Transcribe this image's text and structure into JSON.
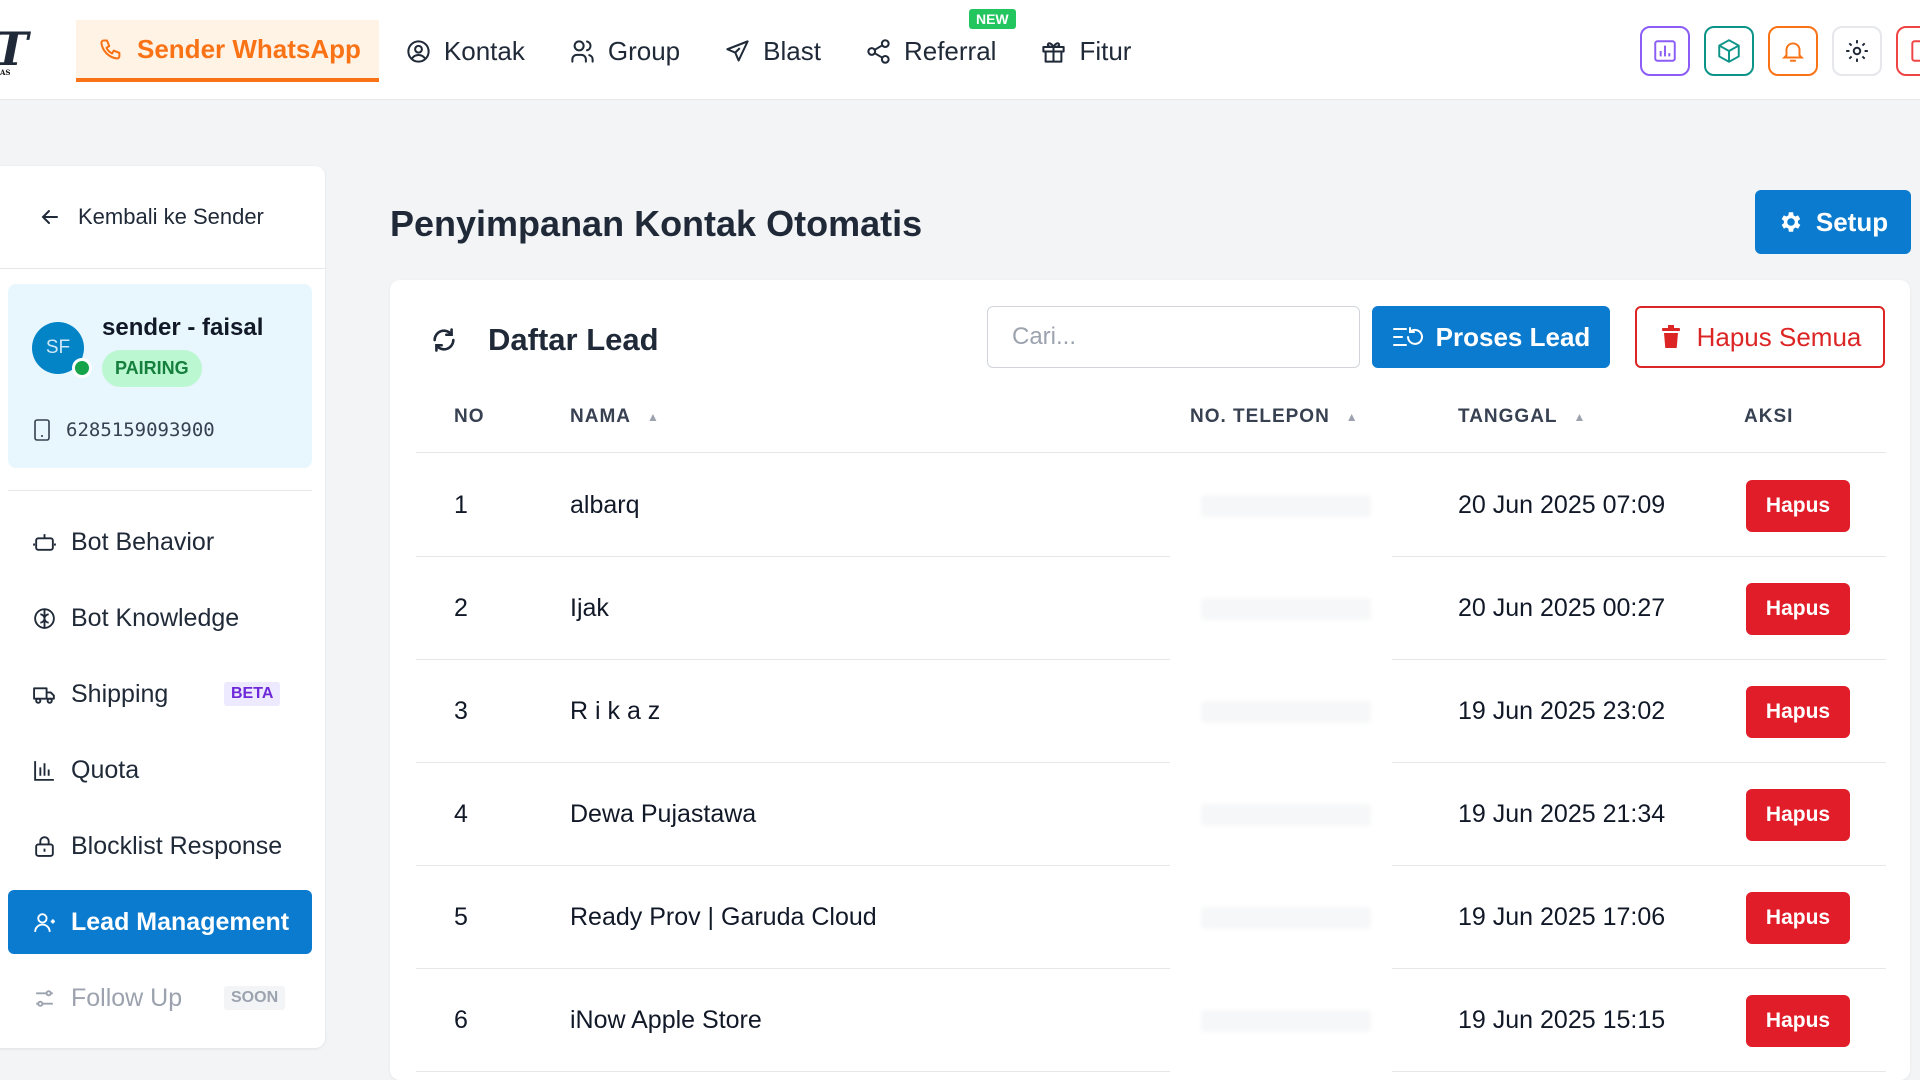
{
  "brand": {
    "logo_text": "T",
    "logo_sub": "AS"
  },
  "nav": {
    "items": [
      {
        "label": "Sender WhatsApp",
        "icon": "phone-icon",
        "active": true
      },
      {
        "label": "Kontak",
        "icon": "user-circle-icon"
      },
      {
        "label": "Group",
        "icon": "users-icon"
      },
      {
        "label": "Blast",
        "icon": "send-icon"
      },
      {
        "label": "Referral",
        "icon": "share-icon",
        "badge": "NEW"
      },
      {
        "label": "Fitur",
        "icon": "gift-icon"
      }
    ]
  },
  "sidebar": {
    "back_label": "Kembali ke Sender",
    "sender": {
      "initials": "SF",
      "name": "sender - faisal",
      "status": "PAIRING",
      "phone": "6285159093900"
    },
    "menu": [
      {
        "label": "Bot Behavior",
        "icon": "robot-icon"
      },
      {
        "label": "Bot Knowledge",
        "icon": "brain-icon"
      },
      {
        "label": "Shipping",
        "icon": "truck-icon",
        "tag": "BETA"
      },
      {
        "label": "Quota",
        "icon": "chart-icon"
      },
      {
        "label": "Blocklist Response",
        "icon": "lock-icon"
      },
      {
        "label": "Lead Management",
        "icon": "user-icon",
        "active": true
      },
      {
        "label": "Follow Up",
        "icon": "sliders-icon",
        "tag": "SOON",
        "disabled": true
      }
    ]
  },
  "main": {
    "title": "Penyimpanan Kontak Otomatis",
    "setup_label": "Setup",
    "card": {
      "title": "Daftar Lead",
      "search_placeholder": "Cari...",
      "proses_label": "Proses Lead",
      "hapus_semua_label": "Hapus Semua"
    },
    "table": {
      "columns": [
        "NO",
        "NAMA",
        "NO. TELEPON",
        "TANGGAL",
        "AKSI"
      ],
      "rows": [
        {
          "no": "1",
          "nama": "albarq",
          "telepon": "",
          "tanggal": "20 Jun 2025 07:09",
          "aksi": "Hapus"
        },
        {
          "no": "2",
          "nama": "Ijak",
          "telepon": "",
          "tanggal": "20 Jun 2025 00:27",
          "aksi": "Hapus"
        },
        {
          "no": "3",
          "nama": "R i k a z",
          "telepon": "",
          "tanggal": "19 Jun 2025 23:02",
          "aksi": "Hapus"
        },
        {
          "no": "4",
          "nama": "Dewa Pujastawa",
          "telepon": "",
          "tanggal": "19 Jun 2025 21:34",
          "aksi": "Hapus"
        },
        {
          "no": "5",
          "nama": "Ready Prov | Garuda Cloud",
          "telepon": "",
          "tanggal": "19 Jun 2025 17:06",
          "aksi": "Hapus"
        },
        {
          "no": "6",
          "nama": "iNow Apple Store",
          "telepon": "",
          "tanggal": "19 Jun 2025 15:15",
          "aksi": "Hapus"
        }
      ]
    }
  },
  "colors": {
    "accent": "#f97316",
    "primary": "#0b7bcf",
    "danger": "#e11d2a",
    "success": "#16a34a"
  }
}
